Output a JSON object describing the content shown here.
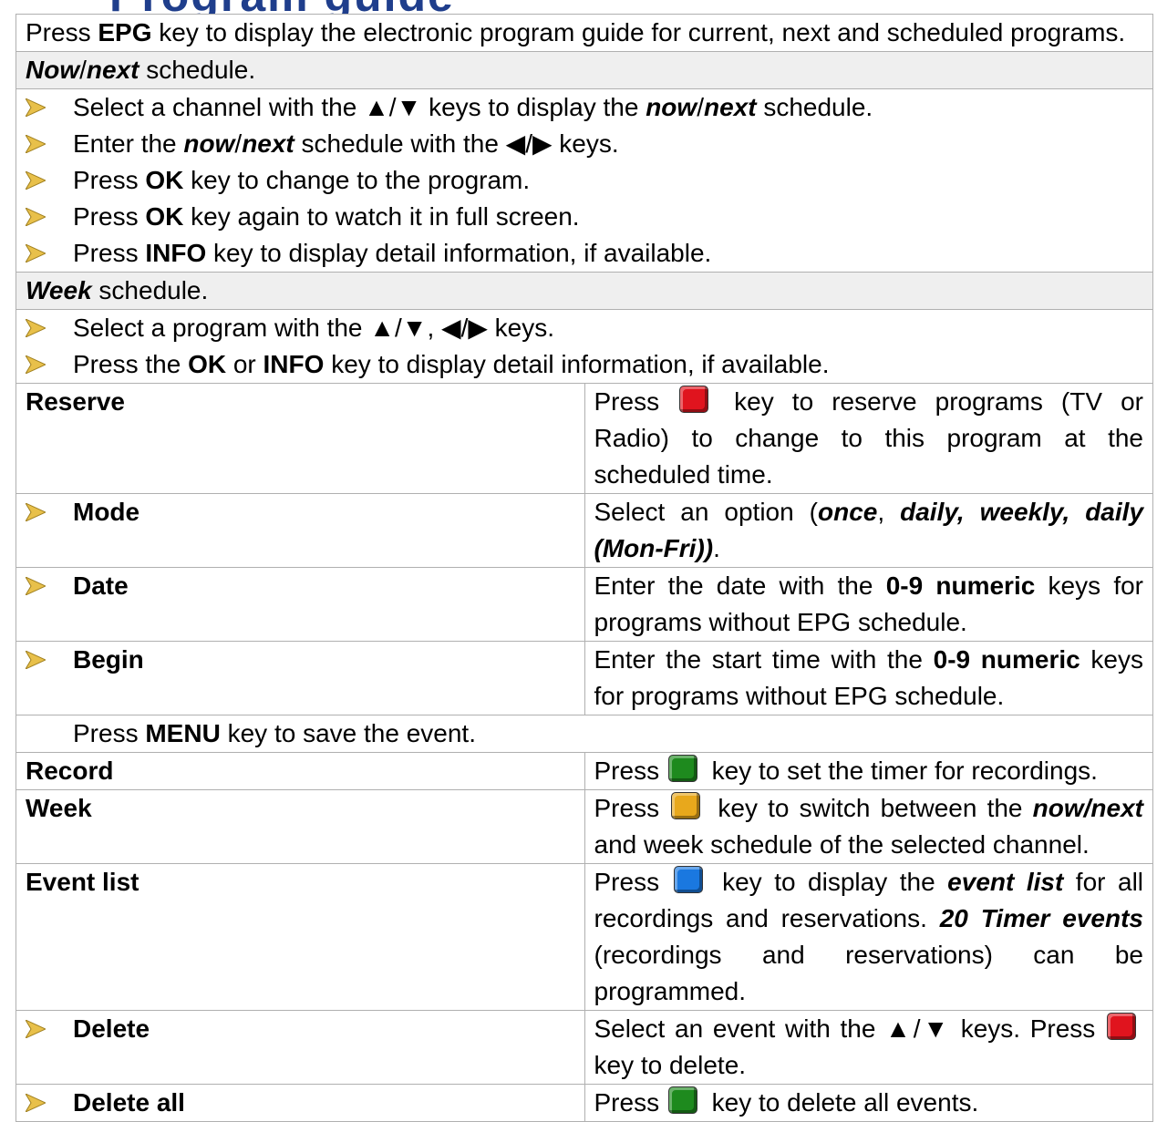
{
  "top_fragment": "Program guide",
  "intro": {
    "p1": "Press ",
    "key": "EPG",
    "p2": " key to display the electronic program guide for current, next and scheduled programs."
  },
  "nownext_header": {
    "a": "Now",
    "sep": "/",
    "b": "next",
    "rest": " schedule."
  },
  "nownext_items": [
    {
      "parts": [
        {
          "t": "Select a channel with the ▲/▼ keys to display the "
        },
        {
          "t": "now",
          "s": "i"
        },
        {
          "t": "/"
        },
        {
          "t": "next",
          "s": "i"
        },
        {
          "t": " schedule."
        }
      ]
    },
    {
      "parts": [
        {
          "t": "Enter the "
        },
        {
          "t": "now",
          "s": "i"
        },
        {
          "t": "/"
        },
        {
          "t": "next",
          "s": "i"
        },
        {
          "t": " schedule with the ◀/▶ keys."
        }
      ]
    },
    {
      "parts": [
        {
          "t": "Press "
        },
        {
          "t": "OK",
          "s": "b"
        },
        {
          "t": " key to change to the program."
        }
      ]
    },
    {
      "parts": [
        {
          "t": "Press "
        },
        {
          "t": "OK",
          "s": "b"
        },
        {
          "t": " key again to watch it in full screen."
        }
      ]
    },
    {
      "parts": [
        {
          "t": "Press "
        },
        {
          "t": "INFO",
          "s": "b"
        },
        {
          "t": " key to display detail information, if available."
        }
      ]
    }
  ],
  "week_header": {
    "a": "Week",
    "rest": " schedule."
  },
  "week_items": [
    {
      "parts": [
        {
          "t": "Select a program with the ▲/▼, ◀/▶ keys."
        }
      ]
    },
    {
      "parts": [
        {
          "t": "Press the "
        },
        {
          "t": "OK",
          "s": "b"
        },
        {
          "t": " or "
        },
        {
          "t": "INFO",
          "s": "b"
        },
        {
          "t": " key to display detail information, if available."
        }
      ]
    }
  ],
  "reserve": {
    "label": "Reserve",
    "pre": "Press ",
    "key_color": "#e0141e",
    "post": " key to reserve programs (TV or Radio) to change to this program at the scheduled time."
  },
  "mode": {
    "label": "Mode",
    "parts": [
      {
        "t": "Select an option ("
      },
      {
        "t": "once",
        "s": "i"
      },
      {
        "t": ", "
      },
      {
        "t": "daily, weekly, daily (Mon-Fri))",
        "s": "i"
      },
      {
        "t": "."
      }
    ]
  },
  "date": {
    "label": "Date",
    "parts": [
      {
        "t": "Enter the date with the "
      },
      {
        "t": "0-9 numeric",
        "s": "b"
      },
      {
        "t": " keys for programs without EPG schedule."
      }
    ]
  },
  "begin": {
    "label": "Begin",
    "parts": [
      {
        "t": "Enter the start time with the "
      },
      {
        "t": "0-9 numeric",
        "s": "b"
      },
      {
        "t": " keys for programs without EPG schedule."
      }
    ]
  },
  "save_note": {
    "pre": "Press ",
    "key": "MENU",
    "post": " key to save the event."
  },
  "record": {
    "label": "Record",
    "pre": "Press ",
    "key_color": "#1e8a1e",
    "post": " key to set the timer for recordings."
  },
  "week": {
    "label": "Week",
    "pre": "Press ",
    "key_color": "#e8a81c",
    "parts": [
      {
        "t": " key to switch between the "
      },
      {
        "t": "now/next",
        "s": "i"
      },
      {
        "t": " and week schedule of the selected channel."
      }
    ]
  },
  "eventlist": {
    "label": "Event list",
    "pre": "Press ",
    "key_color": "#1a78e0",
    "parts": [
      {
        "t": " key to display the "
      },
      {
        "t": "event list",
        "s": "i"
      },
      {
        "t": " for all recordings and reservations. "
      },
      {
        "t": "20 Timer events",
        "s": "i"
      },
      {
        "t": " (recordings and reservations) can be programmed."
      }
    ]
  },
  "delete": {
    "label": "Delete",
    "pre": "Select an event with the ▲/▼ keys. Press ",
    "key_color": "#e0141e",
    "post": " key to delete."
  },
  "delete_all": {
    "label": "Delete all",
    "pre": "Press ",
    "key_color": "#1e8a1e",
    "post": " key to delete all events."
  },
  "icons": {
    "bullet": "arrow-bullet-icon",
    "key": "color-key-icon"
  }
}
